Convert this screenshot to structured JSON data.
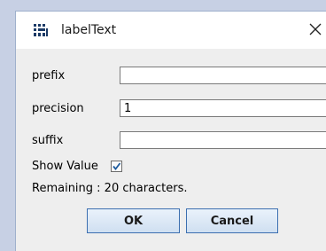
{
  "window": {
    "title": "labelText",
    "icon": "grid-app-icon",
    "close_icon": "close-icon"
  },
  "form": {
    "prefix": {
      "label": "prefix",
      "value": ""
    },
    "precision": {
      "label": "precision",
      "value": "1"
    },
    "suffix": {
      "label": "suffix",
      "value": ""
    },
    "show_value": {
      "label": "Show Value",
      "checked": true
    },
    "remaining": "Remaining : 20 characters."
  },
  "buttons": {
    "ok": "OK",
    "cancel": "Cancel"
  },
  "colors": {
    "background": "#c7d0e4",
    "dialog": "#eeeeee",
    "button_border": "#3c6fb0",
    "check_mark": "#1f5c9e"
  }
}
